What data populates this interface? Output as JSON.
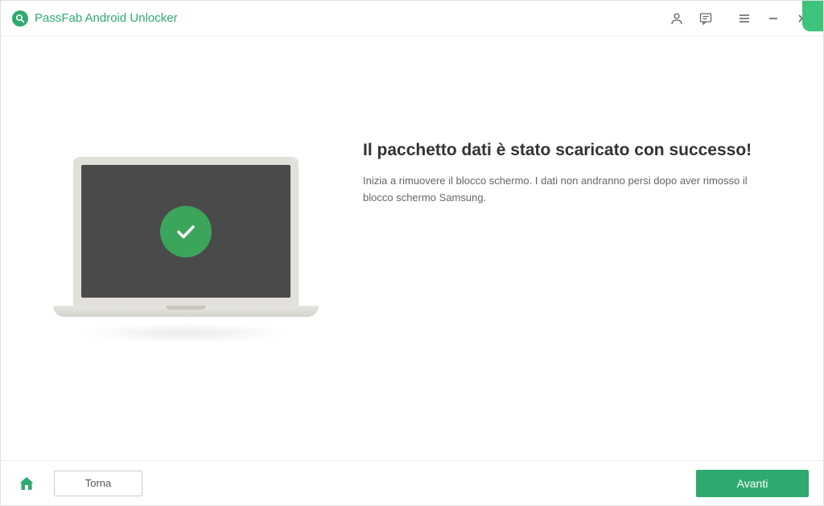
{
  "app": {
    "title": "PassFab Android Unlocker"
  },
  "content": {
    "heading": "Il pacchetto dati è stato scaricato con successo!",
    "description": "Inizia a rimuovere il blocco schermo. I dati non andranno persi dopo aver rimosso il blocco schermo Samsung."
  },
  "footer": {
    "back_label": "Torna",
    "next_label": "Avanti"
  },
  "colors": {
    "brand": "#2eaa6e",
    "success": "#3ba55c"
  }
}
